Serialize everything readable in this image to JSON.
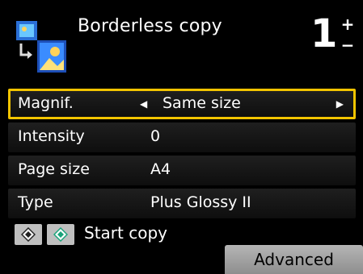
{
  "header": {
    "title": "Borderless copy",
    "copies": "1",
    "stepper": {
      "plus": "+",
      "minus": "−"
    },
    "icon": "borderless-copy-icon"
  },
  "settings": [
    {
      "label": "Magnif.",
      "value": "Same size",
      "selected": true
    },
    {
      "label": "Intensity",
      "value": "0",
      "selected": false
    },
    {
      "label": "Page size",
      "value": "A4",
      "selected": false
    },
    {
      "label": "Type",
      "value": "Plus Glossy II",
      "selected": false
    }
  ],
  "arrows": {
    "left": "◀",
    "right": "▶"
  },
  "footer": {
    "start_copy_label": "Start copy",
    "black_key_icon": "black-start-icon",
    "color_key_icon": "color-start-icon"
  },
  "softkey": {
    "advanced_label": "Advanced"
  },
  "colors": {
    "selection": "#f2c400",
    "background": "#000000",
    "key": "#bfbfbf",
    "color_key_accent": "#1aa37a"
  }
}
